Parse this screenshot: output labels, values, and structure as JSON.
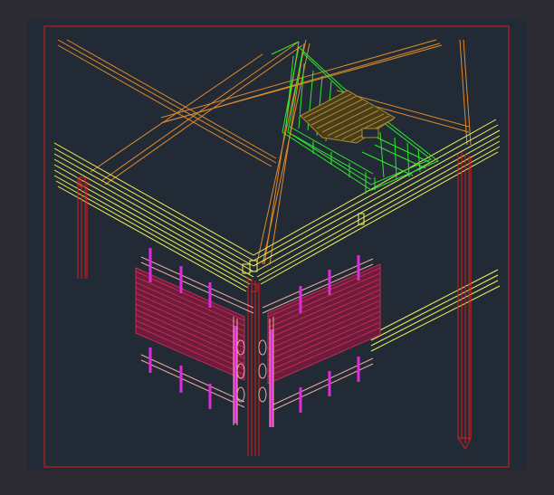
{
  "app": {
    "window_background": "#2c2a32",
    "canvas_background": "#222b35"
  },
  "drawing": {
    "frame_color": "#e01818",
    "layers": [
      {
        "name": "roof-beams",
        "color": "#e08a2a"
      },
      {
        "name": "main-girders",
        "color": "#f2f25a"
      },
      {
        "name": "roof-deck-detail",
        "color": "#2ee82e"
      },
      {
        "name": "deck-planks",
        "color": "#b08a32"
      },
      {
        "name": "columns",
        "color": "#e01818"
      },
      {
        "name": "wall-panel",
        "color": "#c02a5a"
      },
      {
        "name": "panel-frame",
        "color": "#f0a8a0"
      },
      {
        "name": "panel-studs",
        "color": "#e02ae0"
      }
    ]
  }
}
